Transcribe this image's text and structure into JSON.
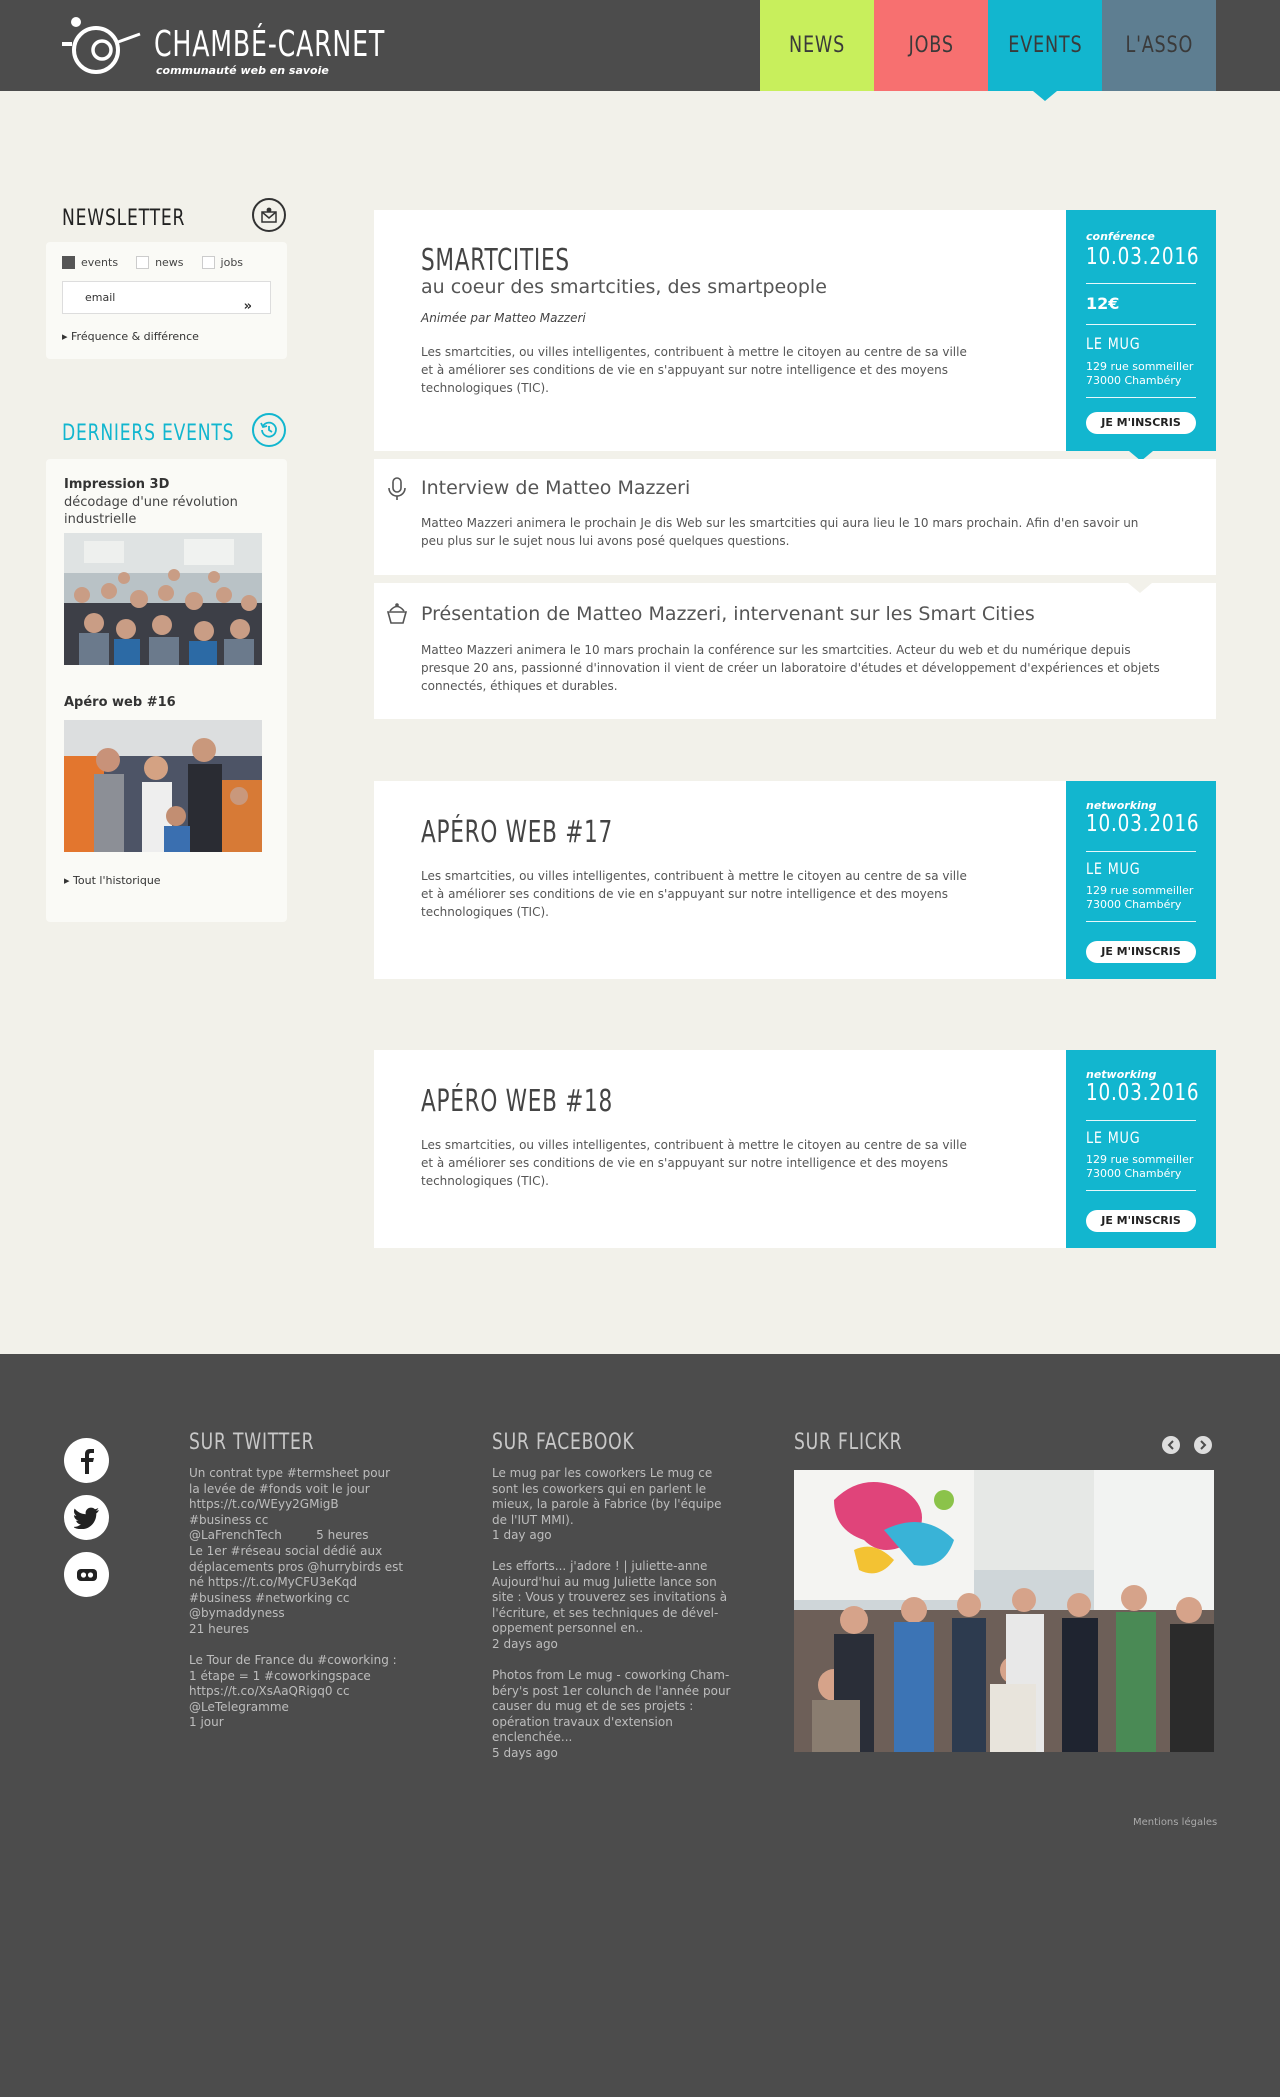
{
  "header": {
    "logo_title": "CHAMBÉ-CARNET",
    "logo_subtitle": "communauté web en savoie",
    "nav": [
      "NEWS",
      "JOBS",
      "EVENTS",
      "L'ASSO"
    ]
  },
  "sidebar": {
    "newsletter": {
      "heading": "NEWSLETTER",
      "checkboxes": [
        {
          "label": "events",
          "checked": true
        },
        {
          "label": "news",
          "checked": false
        },
        {
          "label": "jobs",
          "checked": false
        }
      ],
      "email_value": "email",
      "submit_icon": "»",
      "link": "Fréquence & différence"
    },
    "last_events": {
      "heading": "DERNIERS EVENTS",
      "items": [
        {
          "title": "Impression 3D",
          "subtitle": "décodage d'une révolution industrielle"
        },
        {
          "title": "Apéro web #16",
          "subtitle": ""
        }
      ],
      "history_link": "Tout l'historique"
    }
  },
  "events": [
    {
      "title": "SMARTCITIES",
      "subtitle": "au coeur des smartcities, des smartpeople",
      "byline": "Animée par Matteo Mazzeri",
      "description": "Les smartcities, ou villes intelligentes, contribuent à mettre le citoyen au centre de sa ville et à améliorer ses conditions de vie en s'appuyant sur notre intelligence et des moyens technologiques (TIC).",
      "type": "conférence",
      "date": "10.03.2016",
      "price": "12€",
      "venue": "LE MUG",
      "address_line1": "129 rue sommeiller",
      "address_line2": "73000 Chambéry",
      "button": "JE M'INSCRIS",
      "related": [
        {
          "icon": "microphone-icon",
          "title": "Interview de Matteo Mazzeri",
          "description": "Matteo Mazzeri animera le prochain Je dis Web sur les smartcities qui aura lieu le 10 mars prochain. Afin d'en savoir un peu plus sur le sujet nous lui avons posé quelques questions."
        },
        {
          "icon": "cupcake-icon",
          "title": "Présentation de Matteo Mazzeri, intervenant sur les Smart Cities",
          "description": "Matteo Mazzeri animera le 10 mars prochain la conférence sur les smartcities. Acteur du web et du numérique depuis presque 20 ans, passionné d'innovation il vient de créer un laboratoire d'études et développement d'expériences et objets connectés, éthiques et durables."
        }
      ]
    },
    {
      "title": "APÉRO WEB #17",
      "description": "Les smartcities, ou villes intelligentes, contribuent à mettre le citoyen au centre de sa ville et à améliorer ses conditions de vie en s'appuyant sur notre intelligence et des moyens technologiques (TIC).",
      "type": "networking",
      "date": "10.03.2016",
      "venue": "LE MUG",
      "address_line1": "129 rue sommeiller",
      "address_line2": "73000 Chambéry",
      "button": "JE M'INSCRIS"
    },
    {
      "title": "APÉRO WEB #18",
      "description": "Les smartcities, ou villes intelligentes, contribuent à mettre le citoyen au centre de sa ville et à améliorer ses conditions de vie en s'appuyant sur notre intelligence et des moyens technologiques (TIC).",
      "type": "networking",
      "date": "10.03.2016",
      "venue": "LE MUG",
      "address_line1": "129 rue sommeiller",
      "address_line2": "73000 Chambéry",
      "button": "JE M'INSCRIS"
    }
  ],
  "footer": {
    "social_icons": [
      "facebook-icon",
      "twitter-icon",
      "flickr-icon"
    ],
    "twitter": {
      "heading": "SUR TWITTER",
      "items": [
        {
          "text": "Un contrat type #termsheet pour la levée de #fonds voit le jour https://t.co/WEyy2GMigB #business cc @LaFrenchTech",
          "time": "5 heures"
        },
        {
          "text": "Le 1er #réseau social dédié aux déplacements pros @hurrybirds est né https://t.co/MyCFU3eKqd #business #networking cc @bymaddyness",
          "time": "21 heures"
        },
        {
          "text": "Le Tour de France du #coworking : 1 étape = 1 #coworkingspace https://t.co/XsAaQRigq0 cc @LeTelegramme",
          "time": "1 jour"
        }
      ]
    },
    "facebook": {
      "heading": "SUR FACEBOOK",
      "items": [
        {
          "text": "Le mug par les coworkers Le mug ce sont les coworkers qui en parlent le mieux, la parole à Fabrice (by l'équipe de l'IUT MMI).",
          "time": "1 day ago"
        },
        {
          "text": "Les efforts... j'adore ! | juliette-anne Aujourd'hui au mug Juliette lance son site : Vous y trouverez ses invitations à l'écriture, et ses techniques de dével-oppement personnel en..",
          "time": "2 days ago"
        },
        {
          "text": "Photos from Le mug - coworking Cham-béry's post 1er colunch de l'année pour causer du mug et de ses projets : opération travaux d'extension enclenchée...",
          "time": "5 days ago"
        }
      ]
    },
    "flickr": {
      "heading": "SUR FLICKR"
    },
    "legal": "Mentions légales"
  },
  "colors": {
    "news": "#c8ef5c",
    "jobs": "#f77070",
    "events": "#12b6cf",
    "asso": "#5e7e91",
    "dark": "#4c4c4c",
    "background": "#f2f1ea"
  }
}
